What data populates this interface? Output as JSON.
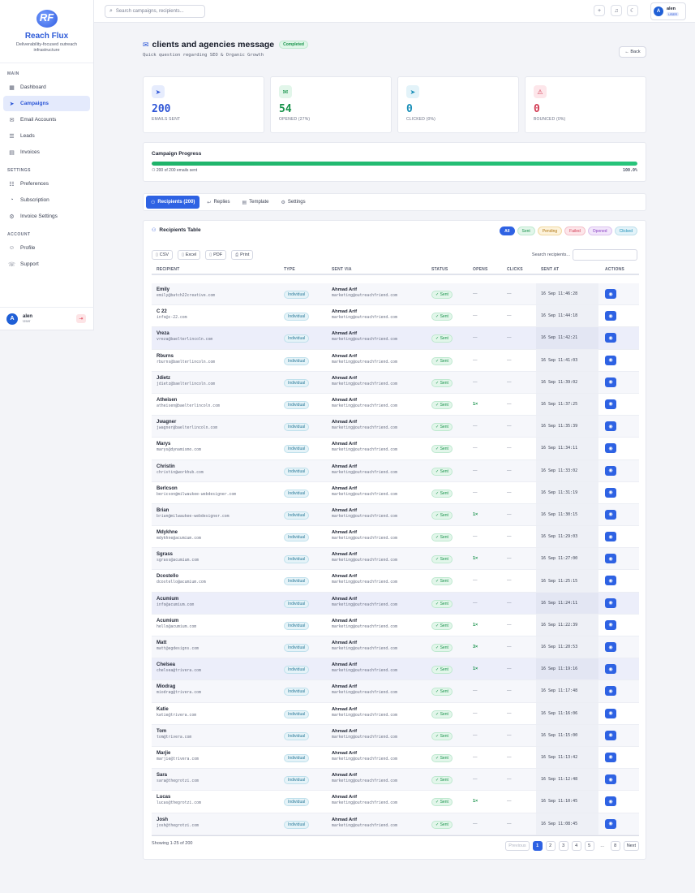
{
  "brand": {
    "name": "Reach Flux",
    "logo_text": "RF",
    "tagline": "Deliverability-focused outreach infrastructure"
  },
  "sidebar": {
    "sections": [
      {
        "label": "MAIN",
        "items": [
          {
            "label": "Dashboard",
            "icon": "dashboard-icon",
            "active": false
          },
          {
            "label": "Campaigns",
            "icon": "send-icon",
            "active": true
          },
          {
            "label": "Email Accounts",
            "icon": "mail-icon",
            "active": false
          },
          {
            "label": "Leads",
            "icon": "leads-icon",
            "active": false
          },
          {
            "label": "Invoices",
            "icon": "invoice-icon",
            "active": false
          }
        ]
      },
      {
        "label": "SETTINGS",
        "items": [
          {
            "label": "Preferences",
            "icon": "sliders-icon",
            "active": false
          },
          {
            "label": "Subscription",
            "icon": "subscription-icon",
            "active": false
          },
          {
            "label": "Invoice Settings",
            "icon": "gear-icon",
            "active": false
          }
        ]
      },
      {
        "label": "ACCOUNT",
        "items": [
          {
            "label": "Profile",
            "icon": "profile-icon",
            "active": false
          },
          {
            "label": "Support",
            "icon": "support-icon",
            "active": false
          }
        ]
      }
    ],
    "user": {
      "avatar": "A",
      "name": "alen",
      "role": "User"
    }
  },
  "topbar": {
    "search_placeholder": "Search campaigns, recipients...",
    "user": {
      "avatar": "A",
      "name": "alen",
      "role": "USER"
    }
  },
  "page": {
    "title": "clients and agencies message",
    "status": "Completed",
    "subtitle": "Quick question regarding SEO & Organic Growth",
    "back_label": "Back"
  },
  "stats": [
    {
      "value": "200",
      "label": "EMAILS SENT",
      "color": "#2e55d6",
      "bg": "#e6ecfd",
      "icon": "send-icon"
    },
    {
      "value": "54",
      "label": "OPENED (27%)",
      "color": "#17924a",
      "bg": "#e2f6ea",
      "icon": "mail-open-icon"
    },
    {
      "value": "0",
      "label": "CLICKED (0%)",
      "color": "#1a8fb8",
      "bg": "#e3f3f9",
      "icon": "cursor-icon"
    },
    {
      "value": "0",
      "label": "BOUNCED (0%)",
      "color": "#d23c54",
      "bg": "#fde6ea",
      "icon": "warning-icon"
    }
  ],
  "progress": {
    "title": "Campaign Progress",
    "summary": "200 of 200 emails sent",
    "percent_label": "100.0%",
    "fraction": 1.0
  },
  "tabs": [
    {
      "label": "Recipients (200)",
      "icon": "users-icon",
      "active": true
    },
    {
      "label": "Replies",
      "icon": "reply-icon",
      "active": false
    },
    {
      "label": "Template",
      "icon": "document-icon",
      "active": false
    },
    {
      "label": "Settings",
      "icon": "gear-icon",
      "active": false
    }
  ],
  "table": {
    "title": "Recipients Table",
    "filters": [
      {
        "label": "All",
        "active": true,
        "color": "#ffffff",
        "bg": "#2e62e3",
        "border": "#2e62e3"
      },
      {
        "label": "Sent",
        "active": false,
        "color": "#17924a",
        "bg": "#e2f6ea",
        "border": "#bfe9d0"
      },
      {
        "label": "Pending",
        "active": false,
        "color": "#b07612",
        "bg": "#fdf3dc",
        "border": "#f1d9a2"
      },
      {
        "label": "Failed",
        "active": false,
        "color": "#d23c54",
        "bg": "#fde6ea",
        "border": "#f4c1ca"
      },
      {
        "label": "Opened",
        "active": false,
        "color": "#8a3fc4",
        "bg": "#f2e6fb",
        "border": "#dcc3ef"
      },
      {
        "label": "Clicked",
        "active": false,
        "color": "#1a8fb8",
        "bg": "#e3f3f9",
        "border": "#bfe0ec"
      }
    ],
    "export_buttons": [
      {
        "label": "CSV",
        "icon": "file-icon"
      },
      {
        "label": "Excel",
        "icon": "file-icon"
      },
      {
        "label": "PDF",
        "icon": "file-icon"
      },
      {
        "label": "Print",
        "icon": "print-icon"
      }
    ],
    "search_label": "Search recipients...",
    "columns": [
      "RECIPIENT",
      "TYPE",
      "SENT VIA",
      "STATUS",
      "OPENS",
      "CLICKS",
      "SENT AT",
      "ACTIONS"
    ],
    "rows": [
      {
        "name": "Emily",
        "email": "emily@batch22creative.com",
        "type": "Individual",
        "via_name": "Ahmad Arif",
        "via_email": "marketing@outreachfriend.com",
        "status": "Sent",
        "opens": "—",
        "clicks": "—",
        "sent_at": "16 Sep 11:46:28"
      },
      {
        "name": "C 22",
        "email": "info@c-22.com",
        "type": "Individual",
        "via_name": "Ahmad Arif",
        "via_email": "marketing@outreachfriend.com",
        "status": "Sent",
        "opens": "—",
        "clicks": "—",
        "sent_at": "16 Sep 11:44:18"
      },
      {
        "name": "Vreza",
        "email": "vreza@baelterlincoln.com",
        "type": "Individual",
        "via_name": "Ahmad Arif",
        "via_email": "marketing@outreachfriend.com",
        "status": "Sent",
        "opens": "—",
        "clicks": "—",
        "sent_at": "16 Sep 11:42:21"
      },
      {
        "name": "Rburns",
        "email": "rburns@baelterlincoln.com",
        "type": "Individual",
        "via_name": "Ahmad Arif",
        "via_email": "marketing@outreachfriend.com",
        "status": "Sent",
        "opens": "—",
        "clicks": "—",
        "sent_at": "16 Sep 11:41:03"
      },
      {
        "name": "Jdietz",
        "email": "jdietz@baelterlincoln.com",
        "type": "Individual",
        "via_name": "Ahmad Arif",
        "via_email": "marketing@outreachfriend.com",
        "status": "Sent",
        "opens": "—",
        "clicks": "—",
        "sent_at": "16 Sep 11:39:02"
      },
      {
        "name": "Atheisen",
        "email": "atheisen@baelterlincoln.com",
        "type": "Individual",
        "via_name": "Ahmad Arif",
        "via_email": "marketing@outreachfriend.com",
        "status": "Sent",
        "opens": "1×",
        "clicks": "—",
        "sent_at": "16 Sep 11:37:25"
      },
      {
        "name": "Jwagner",
        "email": "jwagner@baelterlincoln.com",
        "type": "Individual",
        "via_name": "Ahmad Arif",
        "via_email": "marketing@outreachfriend.com",
        "status": "Sent",
        "opens": "—",
        "clicks": "—",
        "sent_at": "16 Sep 11:35:39"
      },
      {
        "name": "Marys",
        "email": "marys@dynamismo.com",
        "type": "Individual",
        "via_name": "Ahmad Arif",
        "via_email": "marketing@outreachfriend.com",
        "status": "Sent",
        "opens": "—",
        "clicks": "—",
        "sent_at": "16 Sep 11:34:11"
      },
      {
        "name": "Christin",
        "email": "christin@workhub.com",
        "type": "Individual",
        "via_name": "Ahmad Arif",
        "via_email": "marketing@outreachfriend.com",
        "status": "Sent",
        "opens": "—",
        "clicks": "—",
        "sent_at": "16 Sep 11:33:02"
      },
      {
        "name": "Berlcson",
        "email": "bericson@milwaukee-webdesigner.com",
        "type": "Individual",
        "via_name": "Ahmad Arif",
        "via_email": "marketing@outreachfriend.com",
        "status": "Sent",
        "opens": "—",
        "clicks": "—",
        "sent_at": "16 Sep 11:31:19"
      },
      {
        "name": "Brian",
        "email": "brian@milwaukee-webdesigner.com",
        "type": "Individual",
        "via_name": "Ahmad Arif",
        "via_email": "marketing@outreachfriend.com",
        "status": "Sent",
        "opens": "1×",
        "clicks": "—",
        "sent_at": "16 Sep 11:30:15"
      },
      {
        "name": "Mdykhne",
        "email": "mdykhne@acumium.com",
        "type": "Individual",
        "via_name": "Ahmad Arif",
        "via_email": "marketing@outreachfriend.com",
        "status": "Sent",
        "opens": "—",
        "clicks": "—",
        "sent_at": "16 Sep 11:29:03"
      },
      {
        "name": "Sgrass",
        "email": "sgrass@acumium.com",
        "type": "Individual",
        "via_name": "Ahmad Arif",
        "via_email": "marketing@outreachfriend.com",
        "status": "Sent",
        "opens": "1×",
        "clicks": "—",
        "sent_at": "16 Sep 11:27:00"
      },
      {
        "name": "Dcostello",
        "email": "dcostello@acumium.com",
        "type": "Individual",
        "via_name": "Ahmad Arif",
        "via_email": "marketing@outreachfriend.com",
        "status": "Sent",
        "opens": "—",
        "clicks": "—",
        "sent_at": "16 Sep 11:25:15"
      },
      {
        "name": "Acumium",
        "email": "info@acumium.com",
        "type": "Individual",
        "via_name": "Ahmad Arif",
        "via_email": "marketing@outreachfriend.com",
        "status": "Sent",
        "opens": "—",
        "clicks": "—",
        "sent_at": "16 Sep 11:24:11"
      },
      {
        "name": "Acumium",
        "email": "hello@acumium.com",
        "type": "Individual",
        "via_name": "Ahmad Arif",
        "via_email": "marketing@outreachfriend.com",
        "status": "Sent",
        "opens": "1×",
        "clicks": "—",
        "sent_at": "16 Sep 11:22:39"
      },
      {
        "name": "Matt",
        "email": "matt@egdesigns.com",
        "type": "Individual",
        "via_name": "Ahmad Arif",
        "via_email": "marketing@outreachfriend.com",
        "status": "Sent",
        "opens": "3×",
        "clicks": "—",
        "sent_at": "16 Sep 11:20:53"
      },
      {
        "name": "Chelsea",
        "email": "chelsea@trivera.com",
        "type": "Individual",
        "via_name": "Ahmad Arif",
        "via_email": "marketing@outreachfriend.com",
        "status": "Sent",
        "opens": "1×",
        "clicks": "—",
        "sent_at": "16 Sep 11:19:16"
      },
      {
        "name": "Miodrag",
        "email": "miodrag@trivera.com",
        "type": "Individual",
        "via_name": "Ahmad Arif",
        "via_email": "marketing@outreachfriend.com",
        "status": "Sent",
        "opens": "—",
        "clicks": "—",
        "sent_at": "16 Sep 11:17:48"
      },
      {
        "name": "Katie",
        "email": "katie@trivera.com",
        "type": "Individual",
        "via_name": "Ahmad Arif",
        "via_email": "marketing@outreachfriend.com",
        "status": "Sent",
        "opens": "—",
        "clicks": "—",
        "sent_at": "16 Sep 11:16:06"
      },
      {
        "name": "Tom",
        "email": "tom@trivera.com",
        "type": "Individual",
        "via_name": "Ahmad Arif",
        "via_email": "marketing@outreachfriend.com",
        "status": "Sent",
        "opens": "—",
        "clicks": "—",
        "sent_at": "16 Sep 11:15:00"
      },
      {
        "name": "Marjie",
        "email": "marjie@trivera.com",
        "type": "Individual",
        "via_name": "Ahmad Arif",
        "via_email": "marketing@outreachfriend.com",
        "status": "Sent",
        "opens": "—",
        "clicks": "—",
        "sent_at": "16 Sep 11:13:42"
      },
      {
        "name": "Sara",
        "email": "sara@thegrotzi.com",
        "type": "Individual",
        "via_name": "Ahmad Arif",
        "via_email": "marketing@outreachfriend.com",
        "status": "Sent",
        "opens": "—",
        "clicks": "—",
        "sent_at": "16 Sep 11:12:48"
      },
      {
        "name": "Lucas",
        "email": "lucas@thegrotzi.com",
        "type": "Individual",
        "via_name": "Ahmad Arif",
        "via_email": "marketing@outreachfriend.com",
        "status": "Sent",
        "opens": "1×",
        "clicks": "—",
        "sent_at": "16 Sep 11:10:45"
      },
      {
        "name": "Josh",
        "email": "josh@thegrotzi.com",
        "type": "Individual",
        "via_name": "Ahmad Arif",
        "via_email": "marketing@outreachfriend.com",
        "status": "Sent",
        "opens": "—",
        "clicks": "—",
        "sent_at": "16 Sep 11:08:45"
      }
    ],
    "highlighted_rows": [
      2,
      14,
      17
    ],
    "footer": "Showing 1-25 of 200",
    "pagination": [
      "Previous",
      "1",
      "2",
      "3",
      "4",
      "5",
      "...",
      "8",
      "Next"
    ],
    "current_page": "1"
  }
}
